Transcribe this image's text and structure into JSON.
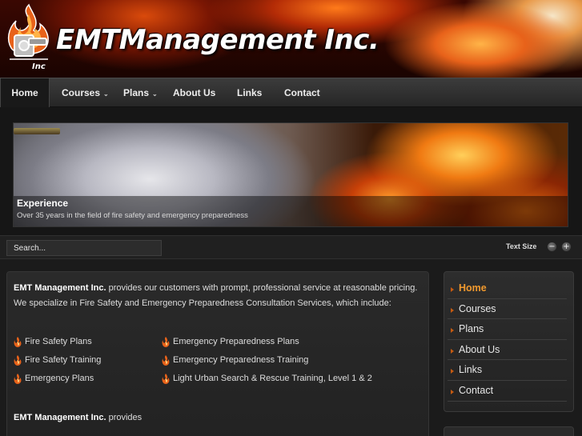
{
  "header": {
    "logo_text": "EMTManagement Inc."
  },
  "nav": {
    "items": [
      {
        "label": "Home"
      },
      {
        "label": "Courses"
      },
      {
        "label": "Plans"
      },
      {
        "label": "About Us"
      },
      {
        "label": "Links"
      },
      {
        "label": "Contact"
      }
    ],
    "active": "Home",
    "chevron": "⌄"
  },
  "slideshow": {
    "caption_title": "Experience",
    "caption_text": "Over 35 years in the field of fire safety and emergency preparedness"
  },
  "toolbar": {
    "search_placeholder": "Search...",
    "text_size_label": "Text Size",
    "decrease_symbol": "−",
    "increase_symbol": "+"
  },
  "content": {
    "company": "EMT Management Inc.",
    "intro_rest": " provides our customers with prompt, professional service at reasonable pricing. We specialize in Fire Safety and Emergency Preparedness Consultation Services, which include:",
    "services_left": [
      "Fire Safety Plans",
      "Fire Safety Training",
      "Emergency Plans"
    ],
    "services_right": [
      "Emergency Preparedness Plans",
      "Emergency Preparedness Training",
      "Light Urban Search & Rescue Training, Level 1 & 2"
    ],
    "provides_rest": " provides"
  },
  "sidebar": {
    "items": [
      {
        "label": "Home"
      },
      {
        "label": "Courses"
      },
      {
        "label": "Plans"
      },
      {
        "label": "About Us"
      },
      {
        "label": "Links"
      },
      {
        "label": "Contact"
      }
    ]
  },
  "colors": {
    "accent": "#f29a2e",
    "background": "#1b1b1b",
    "flame": "#e8621a"
  },
  "icons": {
    "logo": "fire-emblem-icon",
    "service_bullet": "flame-icon",
    "sidebar_bullet": "triangle-bullet-icon"
  }
}
